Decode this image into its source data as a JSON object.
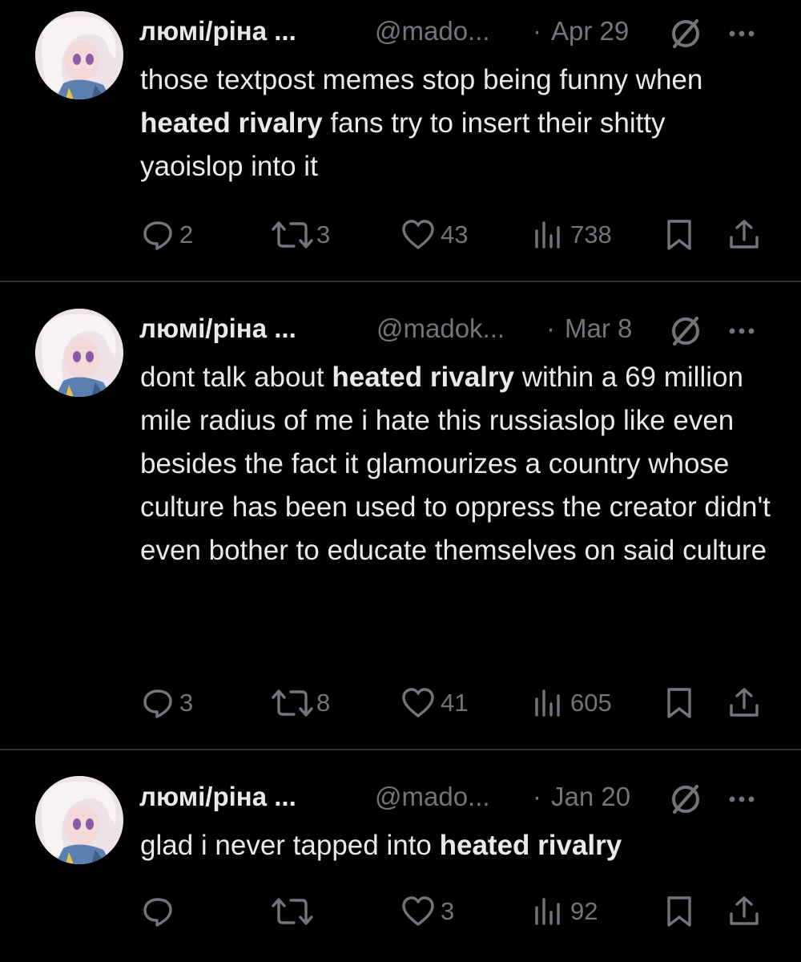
{
  "tweets": [
    {
      "display_name": "люмі/ріна ...",
      "handle": "@mado...",
      "separator": "·",
      "date": "Apr 29",
      "text_segments": [
        {
          "text": "those textpost memes stop being funny when ",
          "bold": false
        },
        {
          "text": "heated rivalry",
          "bold": true
        },
        {
          "text": " fans try to insert their shitty yaoislop into it",
          "bold": false
        }
      ],
      "replies": "2",
      "reposts": "3",
      "likes": "43",
      "views": "738"
    },
    {
      "display_name": "люмі/ріна ...",
      "handle": "@madok...",
      "separator": "·",
      "date": "Mar 8",
      "text_segments": [
        {
          "text": "dont talk about ",
          "bold": false
        },
        {
          "text": "heated rivalry",
          "bold": true
        },
        {
          "text": " within a 69 million mile radius of me i hate this russiaslop like even besides the fact it glamourizes a country whose culture has been used to oppress the creator didn't even bother to educate themselves on said culture",
          "bold": false
        }
      ],
      "replies": "3",
      "reposts": "8",
      "likes": "41",
      "views": "605"
    },
    {
      "display_name": "люмі/ріна ...",
      "handle": "@mado...",
      "separator": "·",
      "date": "Jan 20",
      "text_segments": [
        {
          "text": "glad i never tapped into ",
          "bold": false
        },
        {
          "text": "heated rivalry",
          "bold": true
        }
      ],
      "replies": "",
      "reposts": "",
      "likes": "3",
      "views": "92"
    }
  ],
  "icons": {
    "reply": "reply-icon",
    "repost": "repost-icon",
    "like": "heart-icon",
    "views": "views-icon",
    "bookmark": "bookmark-icon",
    "share": "share-icon",
    "more": "more-icon",
    "badge": "no-sign-icon"
  },
  "colors": {
    "background": "#000000",
    "text": "#e7e9ea",
    "muted": "#71767b",
    "divider": "#2f3336"
  }
}
